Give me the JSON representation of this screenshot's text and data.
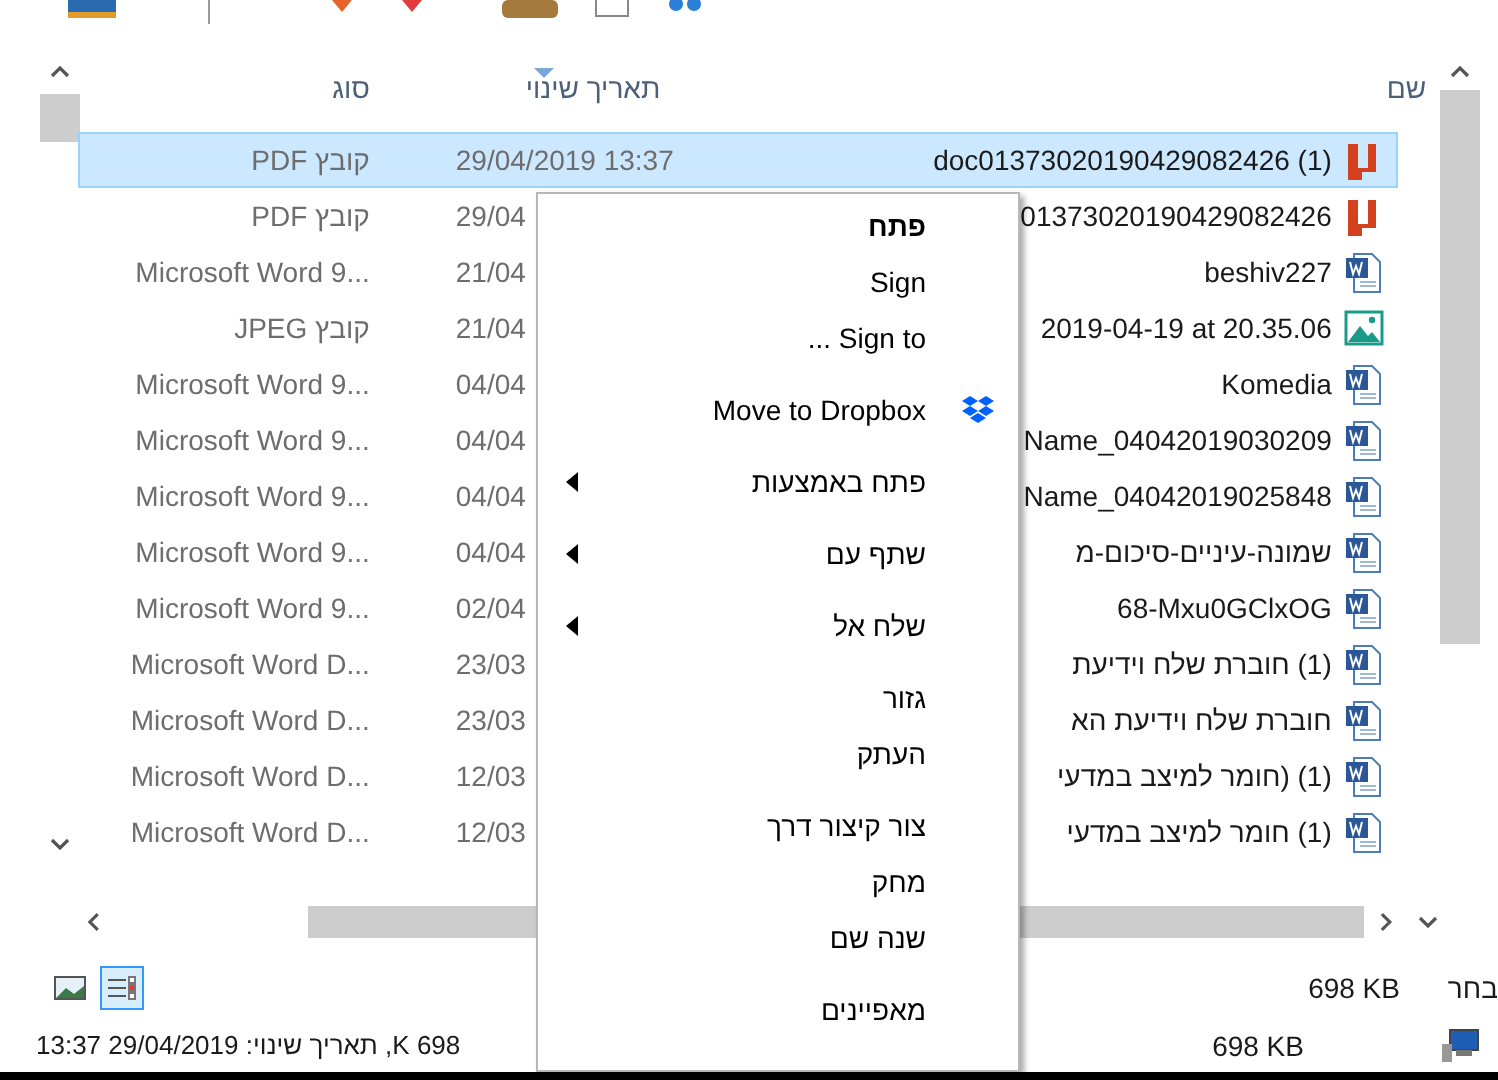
{
  "columns": [
    {
      "kind": "name",
      "label": "שם",
      "sorted": false
    },
    {
      "kind": "date",
      "label": "תאריך שינוי",
      "sorted": true
    },
    {
      "kind": "type",
      "label": "סוג",
      "sorted": false
    }
  ],
  "rows": [
    {
      "kind": "pdf",
      "name": "doc01373020190429082426 (1)",
      "date": "29/04/2019 13:37",
      "type": "קובץ PDF",
      "selected": true
    },
    {
      "kind": "pdf",
      "name": "01373020190429082426",
      "date": "29/04",
      "type": "קובץ PDF",
      "selected": false
    },
    {
      "kind": "word",
      "name": "beshiv227",
      "date": "21/04",
      "type": "Microsoft Word 9...",
      "selected": false
    },
    {
      "kind": "image",
      "name": "2019-04-19 at 20.35.06",
      "date": "21/04",
      "type": "קובץ JPEG",
      "selected": false
    },
    {
      "kind": "word",
      "name": "Komedia",
      "date": "04/04",
      "type": "Microsoft Word 9...",
      "selected": false
    },
    {
      "kind": "word",
      "name": "Name_04042019030209",
      "date": "04/04",
      "type": "Microsoft Word 9...",
      "selected": false
    },
    {
      "kind": "word",
      "name": "Name_04042019025848",
      "date": "04/04",
      "type": "Microsoft Word 9...",
      "selected": false
    },
    {
      "kind": "word",
      "name": "שמונה-עיניים-סיכום-מ",
      "date": "04/04",
      "type": "Microsoft Word 9...",
      "selected": false
    },
    {
      "kind": "word",
      "name": "68-Mxu0GClxOG",
      "date": "02/04",
      "type": "Microsoft Word 9...",
      "selected": false
    },
    {
      "kind": "word",
      "name": "(1) חוברת שלח וידיעת",
      "date": "23/03",
      "type": "Microsoft Word D...",
      "selected": false
    },
    {
      "kind": "word",
      "name": "חוברת שלח וידיעת הא",
      "date": "23/03",
      "type": "Microsoft Word D...",
      "selected": false
    },
    {
      "kind": "word",
      "name": "(1) (חומר למיצב במדעי",
      "date": "12/03",
      "type": "Microsoft Word D...",
      "selected": false
    },
    {
      "kind": "word",
      "name": "(1) חומר למיצב במדעי",
      "date": "12/03",
      "type": "Microsoft Word D...",
      "selected": false
    }
  ],
  "context_menu": {
    "items": [
      {
        "kind": "item",
        "label": "פתח",
        "default": true,
        "submenu": false,
        "has_icon": false
      },
      {
        "kind": "item",
        "label": "Sign",
        "default": false,
        "submenu": false,
        "has_icon": false
      },
      {
        "kind": "item",
        "label": "Sign to ...",
        "default": false,
        "submenu": false,
        "has_icon": false
      },
      {
        "kind": "separator"
      },
      {
        "kind": "item",
        "label": "Move to Dropbox",
        "default": false,
        "submenu": false,
        "has_icon": true
      },
      {
        "kind": "separator"
      },
      {
        "kind": "item",
        "label": "פתח באמצעות",
        "default": false,
        "submenu": true,
        "has_icon": false
      },
      {
        "kind": "separator"
      },
      {
        "kind": "item",
        "label": "שתף עם",
        "default": false,
        "submenu": true,
        "has_icon": false
      },
      {
        "kind": "separator"
      },
      {
        "kind": "item",
        "label": "שלח אל",
        "default": false,
        "submenu": true,
        "has_icon": false
      },
      {
        "kind": "separator"
      },
      {
        "kind": "item",
        "label": "גזור",
        "default": false,
        "submenu": false,
        "has_icon": false
      },
      {
        "kind": "item",
        "label": "העתק",
        "default": false,
        "submenu": false,
        "has_icon": false
      },
      {
        "kind": "separator"
      },
      {
        "kind": "item",
        "label": "צור קיצור דרך",
        "default": false,
        "submenu": false,
        "has_icon": false
      },
      {
        "kind": "item",
        "label": "מחק",
        "default": false,
        "submenu": false,
        "has_icon": false
      },
      {
        "kind": "item",
        "label": "שנה שם",
        "default": false,
        "submenu": false,
        "has_icon": false
      },
      {
        "kind": "separator"
      },
      {
        "kind": "item",
        "label": "מאפיינים",
        "default": false,
        "submenu": false,
        "has_icon": false
      }
    ]
  },
  "status_bar": {
    "views": [
      {
        "kind": "preview",
        "selected": false
      },
      {
        "kind": "details",
        "selected": true
      }
    ],
    "selected_size": "698 KB",
    "selected_label": "בחר",
    "details": "698 K, תאריך שינוי: 29/04/2019 13:37",
    "size": "698 KB"
  }
}
